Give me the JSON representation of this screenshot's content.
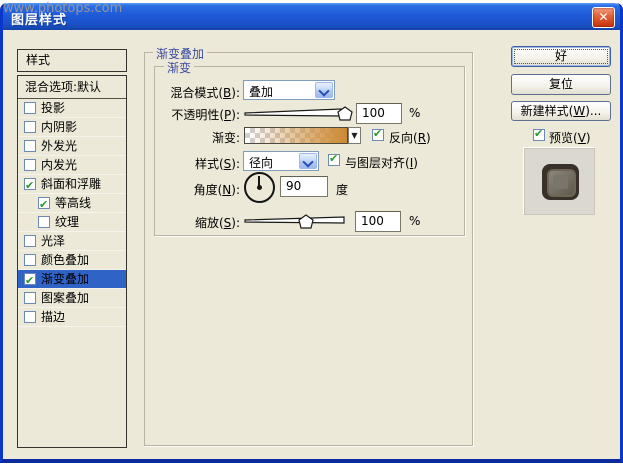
{
  "watermark": "www.photops.com",
  "window": {
    "title": "图层样式",
    "close_glyph": "✕"
  },
  "icons": {
    "close": "close-icon → ✕",
    "combo_arrow": "chevron-down-icon → CSS chevron",
    "checkbox_check": "check-icon → ✔",
    "gradient_dropdown": "dropdown-arrow-icon → ▼",
    "angle_dial": "angle-dial-icon → circle with needle at 90°"
  },
  "colors": {
    "dialog_bg": "#ece9d8",
    "titlebar_blue": "#1e5ad8",
    "selection_blue": "#2f63c5",
    "group_label_blue": "#3a4a9f",
    "gradient_orange": "#cd8a35",
    "check_green": "#259b25",
    "close_red": "#cc3a11"
  },
  "sidebar": {
    "header": "样式",
    "blending_row": "混合选项:默认",
    "items": [
      {
        "label": "投影",
        "checked": false,
        "indent": false,
        "selected": false
      },
      {
        "label": "内阴影",
        "checked": false,
        "indent": false,
        "selected": false
      },
      {
        "label": "外发光",
        "checked": false,
        "indent": false,
        "selected": false
      },
      {
        "label": "内发光",
        "checked": false,
        "indent": false,
        "selected": false
      },
      {
        "label": "斜面和浮雕",
        "checked": true,
        "indent": false,
        "selected": false
      },
      {
        "label": "等高线",
        "checked": true,
        "indent": true,
        "selected": false
      },
      {
        "label": "纹理",
        "checked": false,
        "indent": true,
        "selected": false
      },
      {
        "label": "光泽",
        "checked": false,
        "indent": false,
        "selected": false
      },
      {
        "label": "颜色叠加",
        "checked": false,
        "indent": false,
        "selected": false
      },
      {
        "label": "渐变叠加",
        "checked": true,
        "indent": false,
        "selected": true
      },
      {
        "label": "图案叠加",
        "checked": false,
        "indent": false,
        "selected": false
      },
      {
        "label": "描边",
        "checked": false,
        "indent": false,
        "selected": false
      }
    ]
  },
  "main": {
    "group_title": "渐变叠加",
    "subgroup_title": "渐变",
    "blend_mode": {
      "label": "混合模式(B):",
      "value": "叠加"
    },
    "opacity": {
      "label": "不透明性(P):",
      "value": "100",
      "unit": "%",
      "slider_percent": 97
    },
    "gradient": {
      "label": "渐变:",
      "reverse_label": "反向(R)",
      "reverse_checked": true,
      "swatch": "transparent-to-orange gradient over checkerboard"
    },
    "style": {
      "label": "样式(S):",
      "value": "径向",
      "align_label": "与图层对齐(I)",
      "align_checked": true
    },
    "angle": {
      "label": "角度(N):",
      "value": "90",
      "unit": "度",
      "needle_degrees": 90
    },
    "scale": {
      "label": "缩放(S):",
      "value": "100",
      "unit": "%",
      "slider_percent": 60
    }
  },
  "actions": {
    "ok": "好",
    "reset": "复位",
    "new_style": "新建样式(W)...",
    "preview_label": "预览(V)",
    "preview_checked": true
  }
}
